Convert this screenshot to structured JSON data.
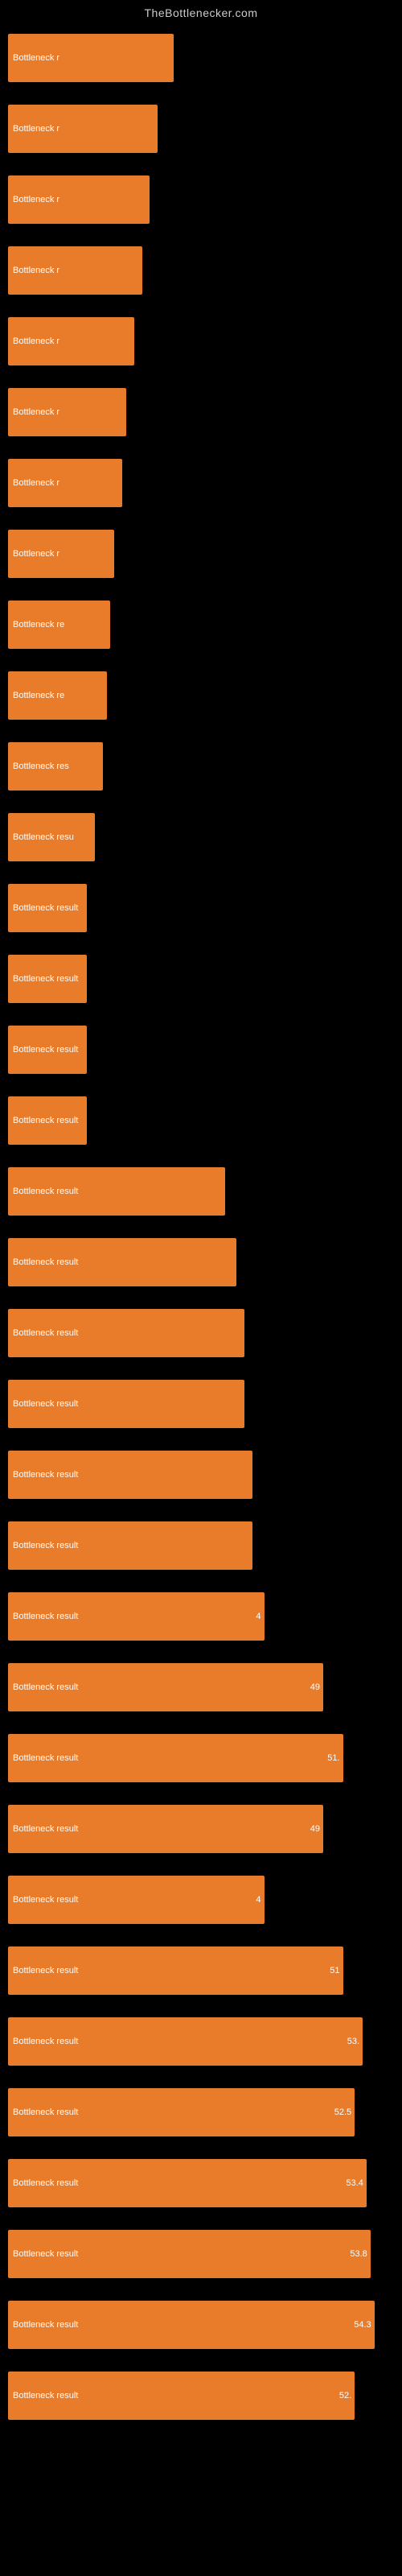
{
  "site": {
    "title": "TheBottlenecker.com"
  },
  "bars": [
    {
      "label": "Bottleneck r",
      "value": "",
      "width": 42
    },
    {
      "label": "Bottleneck r",
      "value": "",
      "width": 38
    },
    {
      "label": "Bottleneck r",
      "value": "",
      "width": 36
    },
    {
      "label": "Bottleneck r",
      "value": "",
      "width": 34
    },
    {
      "label": "Bottleneck r",
      "value": "",
      "width": 32
    },
    {
      "label": "Bottleneck r",
      "value": "",
      "width": 30
    },
    {
      "label": "Bottleneck r",
      "value": "",
      "width": 29
    },
    {
      "label": "Bottleneck r",
      "value": "",
      "width": 27
    },
    {
      "label": "Bottleneck re",
      "value": "",
      "width": 26
    },
    {
      "label": "Bottleneck re",
      "value": "",
      "width": 25
    },
    {
      "label": "Bottleneck res",
      "value": "",
      "width": 24
    },
    {
      "label": "Bottleneck resu",
      "value": "",
      "width": 22
    },
    {
      "label": "Bottleneck result",
      "value": "",
      "width": 20
    },
    {
      "label": "Bottleneck result",
      "value": "",
      "width": 20
    },
    {
      "label": "Bottleneck result",
      "value": "",
      "width": 20
    },
    {
      "label": "Bottleneck result",
      "value": "",
      "width": 20
    },
    {
      "label": "Bottleneck result",
      "value": "",
      "width": 55
    },
    {
      "label": "Bottleneck result",
      "value": "",
      "width": 58
    },
    {
      "label": "Bottleneck result",
      "value": "",
      "width": 60
    },
    {
      "label": "Bottleneck result",
      "value": "",
      "width": 60
    },
    {
      "label": "Bottleneck result",
      "value": "",
      "width": 62
    },
    {
      "label": "Bottleneck result",
      "value": "",
      "width": 62
    },
    {
      "label": "Bottleneck result",
      "value": "4",
      "width": 65
    },
    {
      "label": "Bottleneck result",
      "value": "49",
      "width": 80
    },
    {
      "label": "Bottleneck result",
      "value": "51.",
      "width": 85
    },
    {
      "label": "Bottleneck result",
      "value": "49",
      "width": 80
    },
    {
      "label": "Bottleneck result",
      "value": "4",
      "width": 65
    },
    {
      "label": "Bottleneck result",
      "value": "51",
      "width": 85
    },
    {
      "label": "Bottleneck result",
      "value": "53.",
      "width": 90
    },
    {
      "label": "Bottleneck result",
      "value": "52.5",
      "width": 88
    },
    {
      "label": "Bottleneck result",
      "value": "53.4",
      "width": 91
    },
    {
      "label": "Bottleneck result",
      "value": "53.8",
      "width": 92
    },
    {
      "label": "Bottleneck result",
      "value": "54.3",
      "width": 93
    },
    {
      "label": "Bottleneck result",
      "value": "52.",
      "width": 88
    }
  ]
}
